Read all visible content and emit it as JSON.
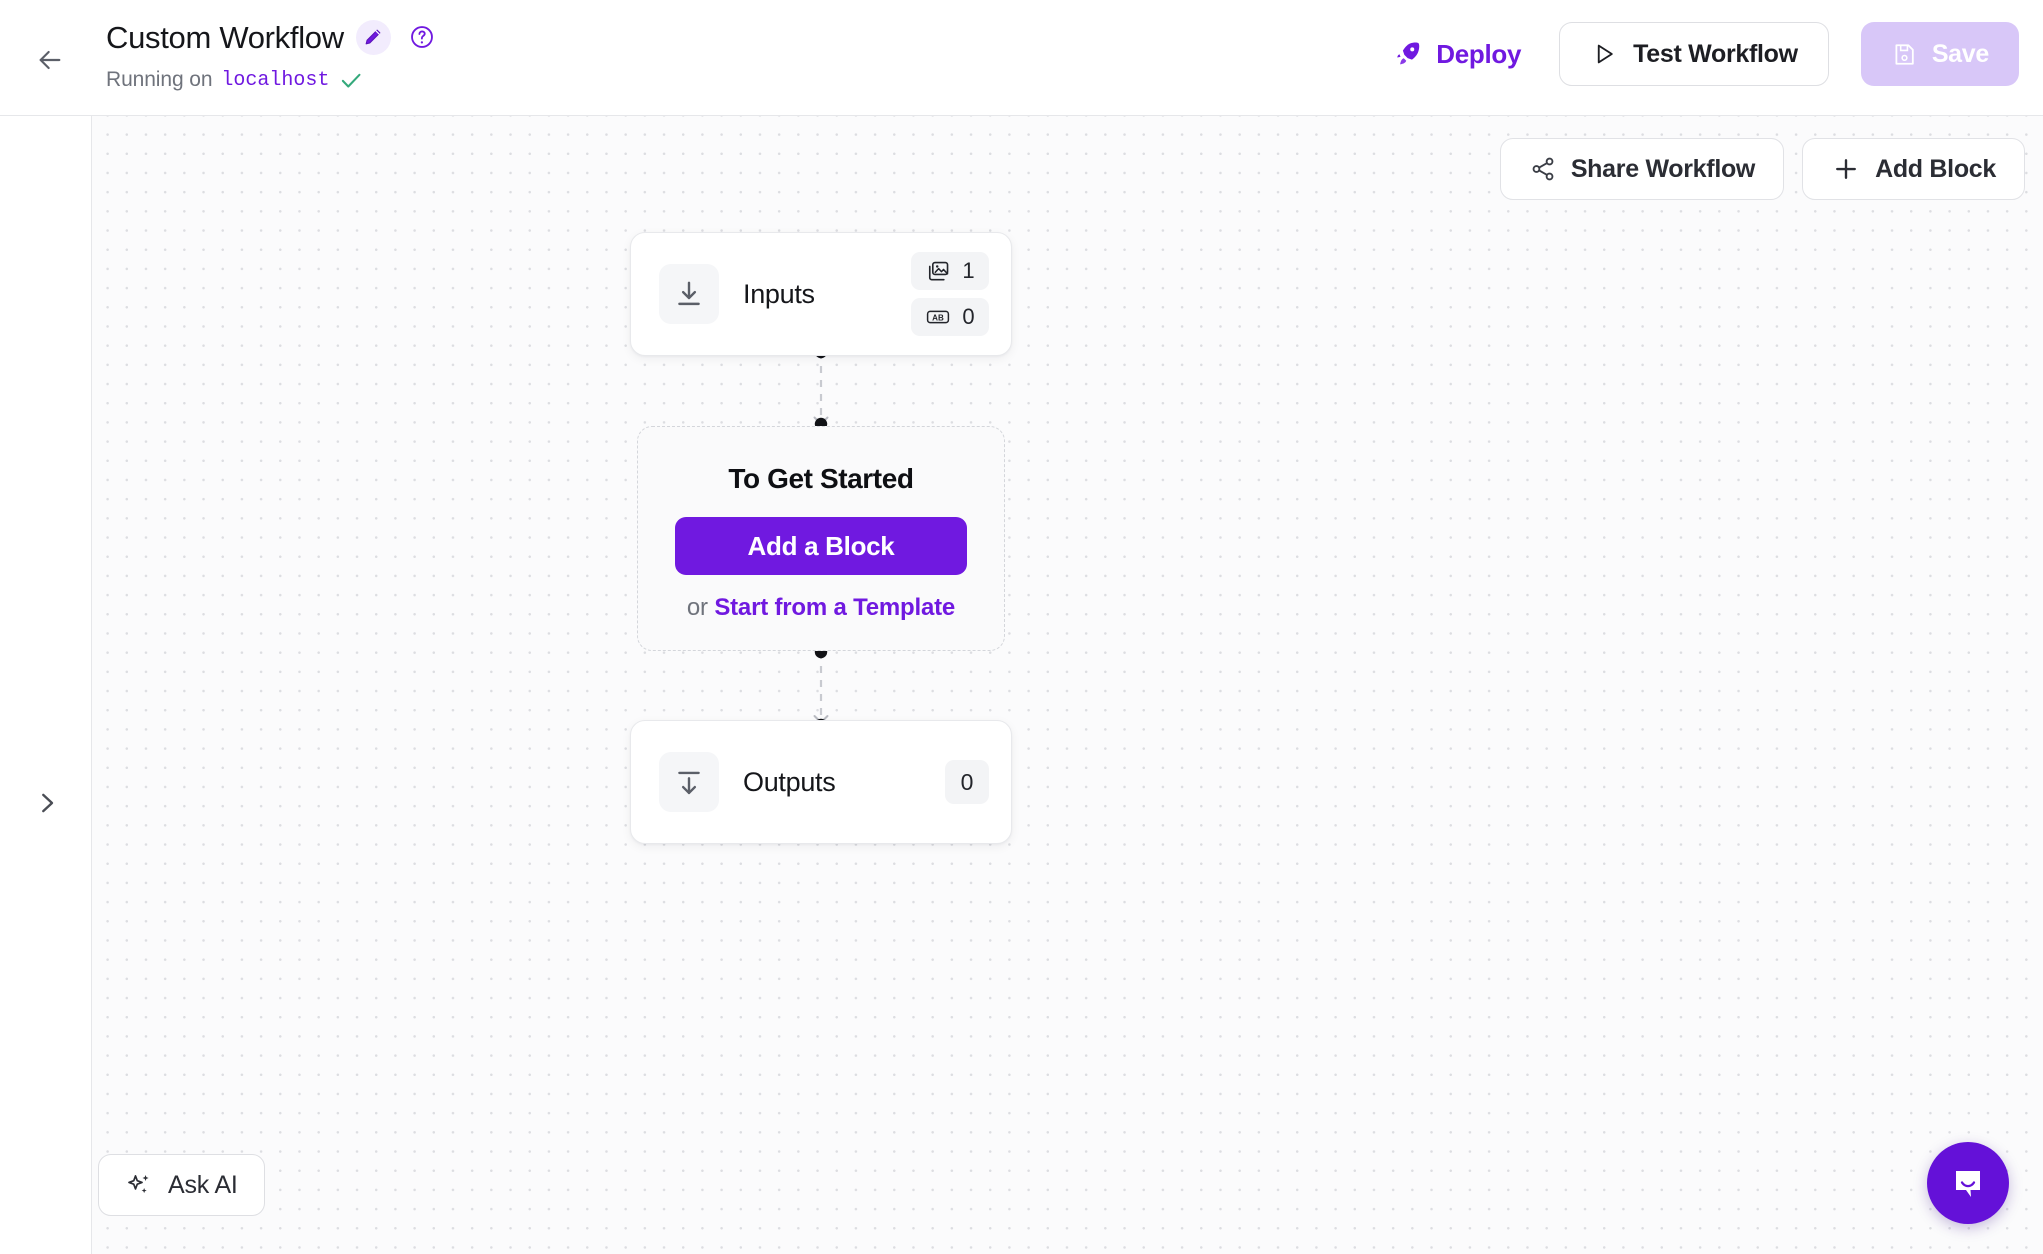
{
  "header": {
    "back_icon": "arrow-left-icon",
    "title": "Custom Workflow",
    "edit_icon": "pencil-icon",
    "help_icon": "question-mark-circle-icon",
    "status_prefix": "Running on",
    "status_host": "localhost",
    "status_check_icon": "check-icon",
    "deploy": {
      "label": "Deploy",
      "icon": "rocket-icon"
    },
    "test": {
      "label": "Test Workflow",
      "icon": "play-icon"
    },
    "save": {
      "label": "Save",
      "icon": "floppy-disk-icon",
      "disabled": true
    }
  },
  "left_rail": {
    "expand_icon": "chevron-right-icon"
  },
  "canvas": {
    "share_workflow": {
      "label": "Share Workflow",
      "icon": "share-nodes-icon"
    },
    "add_block": {
      "label": "Add Block",
      "icon": "plus-icon"
    },
    "nodes": {
      "inputs": {
        "title": "Inputs",
        "icon": "download-arrow-to-line-icon",
        "badges": [
          {
            "icon": "images-icon",
            "count": "1"
          },
          {
            "icon": "ab-text-icon",
            "count": "0"
          }
        ]
      },
      "outputs": {
        "title": "Outputs",
        "icon": "upload-arrow-from-line-icon",
        "count": "0"
      }
    },
    "start_card": {
      "title": "To Get Started",
      "primary_button": "Add a Block",
      "or_text": "or ",
      "template_link": "Start from a Template"
    },
    "ask_ai": {
      "label": "Ask AI",
      "icon": "sparkles-icon"
    },
    "chat_launcher": {
      "icon": "chat-bubble-smile-icon"
    }
  },
  "colors": {
    "accent_purple": "#7019e0",
    "accent_purple_soft": "#d8c7f8",
    "accent_purple_tint": "#f2ecfd",
    "success_green": "#34a97b",
    "text_primary": "#15161a",
    "text_muted": "#6f737c",
    "canvas_bg": "#fbfbfc",
    "canvas_dot": "#dcdde1",
    "chat_purple": "#6411d8"
  }
}
